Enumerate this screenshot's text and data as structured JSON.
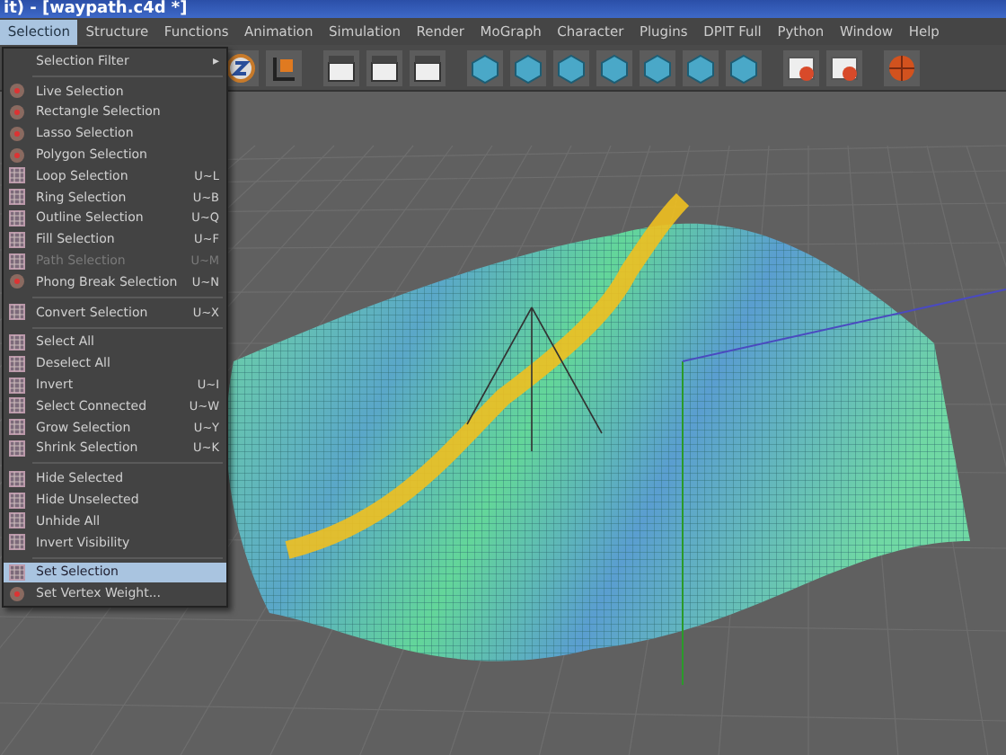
{
  "window": {
    "title": "it) - [waypath.c4d *]"
  },
  "menubar": [
    {
      "label": "Selection",
      "selected": true
    },
    {
      "label": "Structure",
      "selected": false
    },
    {
      "label": "Functions",
      "selected": false
    },
    {
      "label": "Animation",
      "selected": false
    },
    {
      "label": "Simulation",
      "selected": false
    },
    {
      "label": "Render",
      "selected": false
    },
    {
      "label": "MoGraph",
      "selected": false
    },
    {
      "label": "Character",
      "selected": false
    },
    {
      "label": "Plugins",
      "selected": false
    },
    {
      "label": "DPIT Full",
      "selected": false
    },
    {
      "label": "Python",
      "selected": false
    },
    {
      "label": "Window",
      "selected": false
    },
    {
      "label": "Help",
      "selected": false
    }
  ],
  "menu": [
    {
      "kind": "submenu",
      "label": "Selection Filter",
      "arrow": "▸"
    },
    {
      "kind": "separator"
    },
    {
      "kind": "tool",
      "label": "Live Selection",
      "disabled": false,
      "selected": false
    },
    {
      "kind": "tool",
      "label": "Rectangle Selection",
      "disabled": false,
      "selected": false
    },
    {
      "kind": "tool",
      "label": "Lasso Selection",
      "disabled": false,
      "selected": false
    },
    {
      "kind": "tool",
      "label": "Polygon Selection",
      "disabled": false,
      "selected": false
    },
    {
      "kind": "item",
      "label": "Loop Selection",
      "shortcut": "U~L",
      "disabled": false,
      "selected": false
    },
    {
      "kind": "item",
      "label": "Ring Selection",
      "shortcut": "U~B",
      "disabled": false,
      "selected": false
    },
    {
      "kind": "item",
      "label": "Outline Selection",
      "shortcut": "U~Q",
      "disabled": false,
      "selected": false
    },
    {
      "kind": "item",
      "label": "Fill Selection",
      "shortcut": "U~F",
      "disabled": false,
      "selected": false
    },
    {
      "kind": "item",
      "label": "Path Selection",
      "shortcut": "U~M",
      "disabled": true,
      "selected": false
    },
    {
      "kind": "tool",
      "label": "Phong Break Selection",
      "shortcut": "U~N",
      "disabled": false,
      "selected": false
    },
    {
      "kind": "separator"
    },
    {
      "kind": "item",
      "label": "Convert Selection",
      "shortcut": "U~X",
      "disabled": false,
      "selected": false
    },
    {
      "kind": "separator"
    },
    {
      "kind": "item",
      "label": "Select All",
      "disabled": false,
      "selected": false
    },
    {
      "kind": "item",
      "label": "Deselect All",
      "disabled": false,
      "selected": false
    },
    {
      "kind": "item",
      "label": "Invert",
      "shortcut": "U~I",
      "disabled": false,
      "selected": false
    },
    {
      "kind": "item",
      "label": "Select Connected",
      "shortcut": "U~W",
      "disabled": false,
      "selected": false
    },
    {
      "kind": "item",
      "label": "Grow Selection",
      "shortcut": "U~Y",
      "disabled": false,
      "selected": false
    },
    {
      "kind": "item",
      "label": "Shrink Selection",
      "shortcut": "U~K",
      "disabled": false,
      "selected": false
    },
    {
      "kind": "separator"
    },
    {
      "kind": "item",
      "label": "Hide Selected",
      "disabled": false,
      "selected": false
    },
    {
      "kind": "item",
      "label": "Hide Unselected",
      "disabled": false,
      "selected": false
    },
    {
      "kind": "item",
      "label": "Unhide All",
      "disabled": false,
      "selected": false
    },
    {
      "kind": "item",
      "label": "Invert Visibility",
      "disabled": false,
      "selected": false
    },
    {
      "kind": "separator"
    },
    {
      "kind": "item",
      "label": "Set Selection",
      "disabled": false,
      "selected": true
    },
    {
      "kind": "tool",
      "label": "Set Vertex Weight...",
      "disabled": false,
      "selected": false
    }
  ]
}
